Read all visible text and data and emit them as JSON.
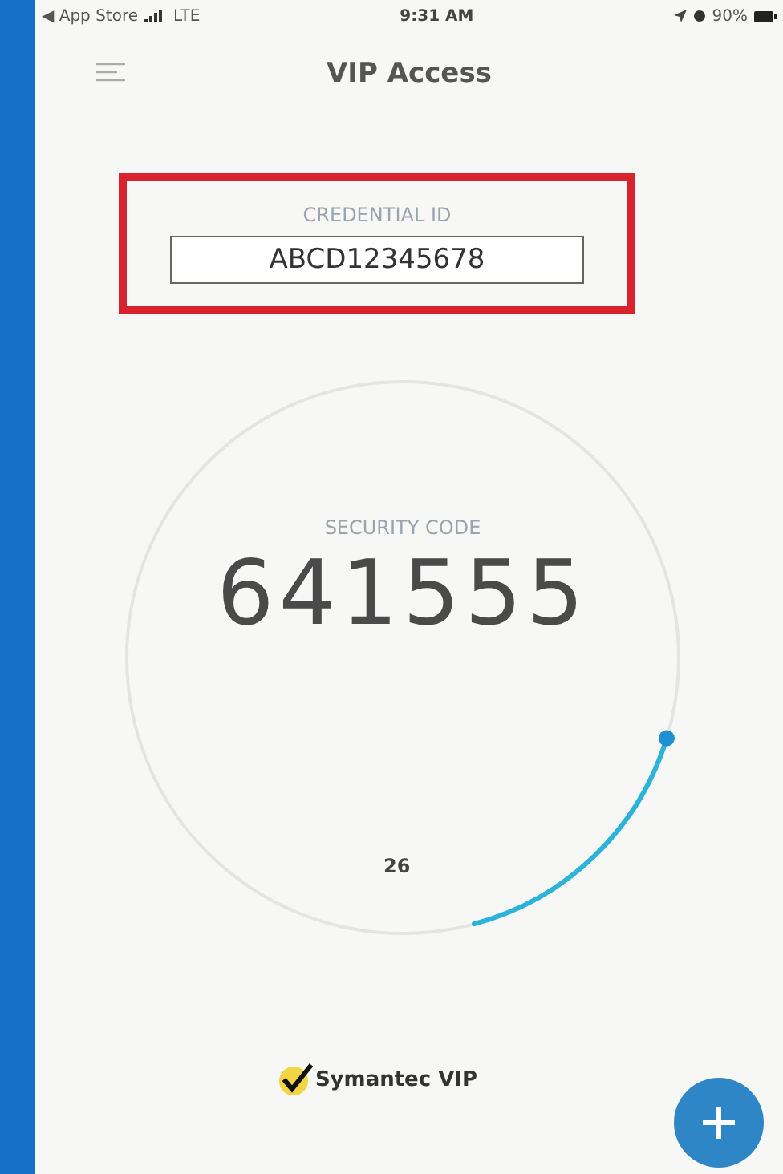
{
  "status_bar": {
    "back": "◀ App Store",
    "network": "LTE",
    "time": "9:31 AM",
    "battery": "90%"
  },
  "header": {
    "title": "VIP Access"
  },
  "credential": {
    "label": "CREDENTIAL ID",
    "value": "ABCD12345678",
    "highlighted": true
  },
  "security_code": {
    "label": "SECURITY CODE",
    "code": "641555",
    "seconds": "26"
  },
  "brand": {
    "name": "Symantec VIP"
  }
}
